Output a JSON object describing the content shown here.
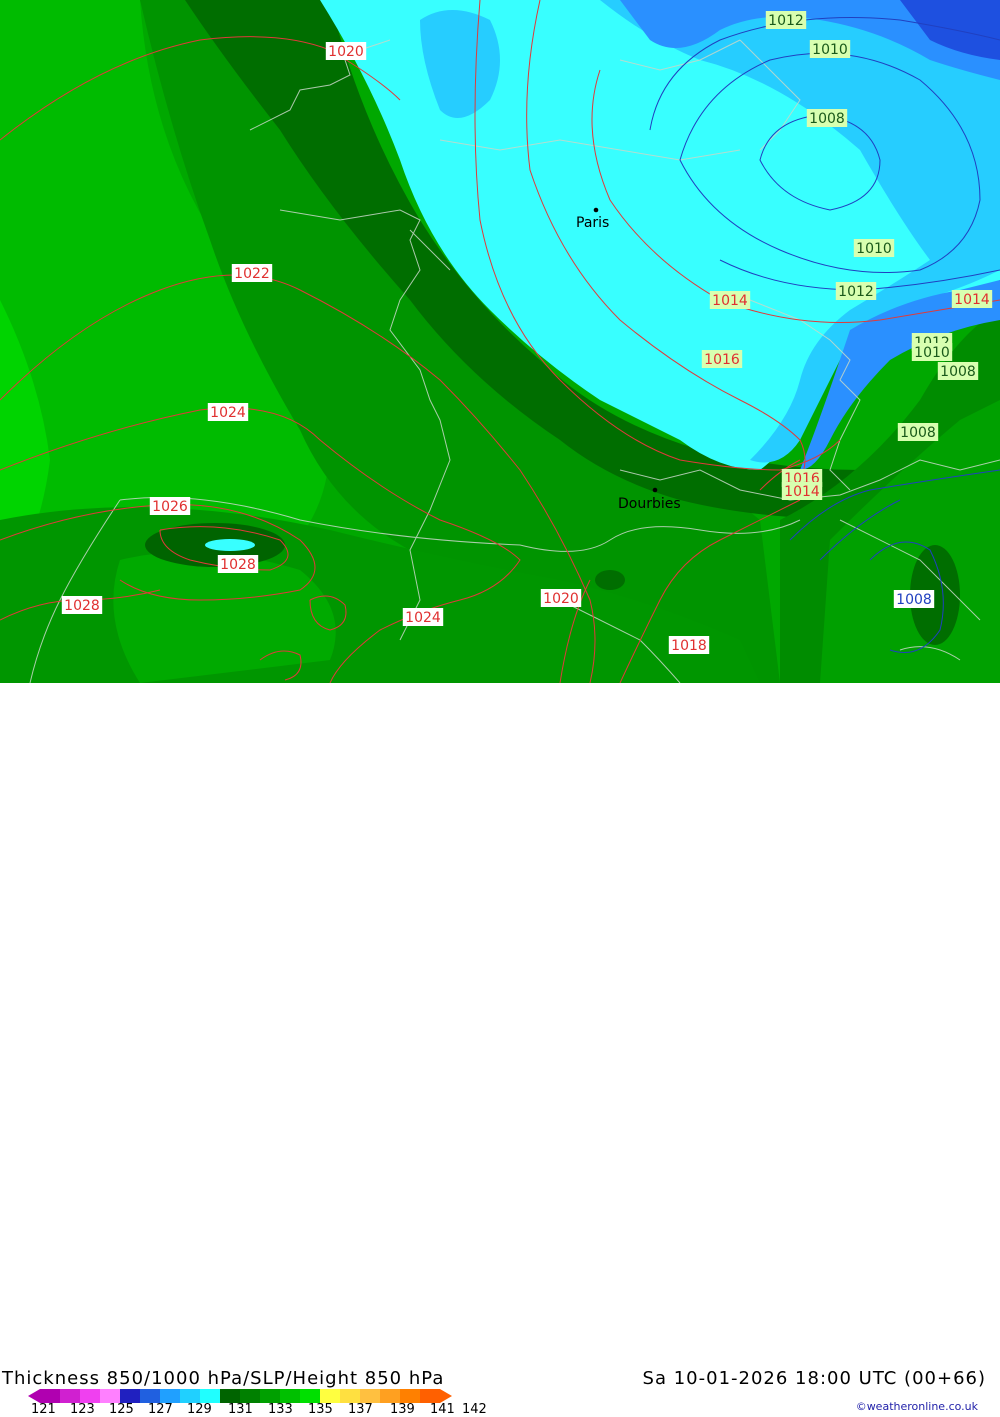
{
  "title": "Thickness 850/1000 hPa/SLP/Height 850 hPa",
  "datetime": "Sa 10-01-2026 18:00 UTC (00+66)",
  "credit": "©weatheronline.co.uk",
  "cities": [
    {
      "name": "Paris"
    },
    {
      "name": "Dourbies"
    }
  ],
  "isobar_labels": {
    "red": [
      "1020",
      "1022",
      "1024",
      "1026",
      "1028",
      "1028",
      "1024",
      "1020",
      "1018",
      "1014",
      "1016",
      "1016",
      "1014",
      "1014"
    ],
    "blue": [
      "1012",
      "1010",
      "1008",
      "1010",
      "1012",
      "1012",
      "1010",
      "1008",
      "1008",
      "1008"
    ]
  },
  "scale": {
    "ticks": [
      "121",
      "123",
      "125",
      "127",
      "129",
      "131",
      "133",
      "135",
      "137",
      "139",
      "141",
      "142"
    ],
    "colors": [
      "#b000b0",
      "#d020d0",
      "#f040f0",
      "#ff80ff",
      "#2020c0",
      "#2060e0",
      "#20a0ff",
      "#20d0ff",
      "#20ffff",
      "#006400",
      "#008000",
      "#00a000",
      "#00c000",
      "#00e000",
      "#ffff40",
      "#ffe040",
      "#ffc040",
      "#ffa020",
      "#ff8000",
      "#ff6000"
    ]
  },
  "colors": {
    "dark_green": "#006e00",
    "mid_green": "#009000",
    "green": "#00a800",
    "light_green": "#00c000",
    "bright_green": "#00d800",
    "cyan": "#38ffff",
    "sky": "#20d0ff",
    "blue": "#2090ff",
    "deep_blue": "#1e50e0",
    "isobar_red": "#e03030",
    "isobar_blue": "#2040c0"
  }
}
